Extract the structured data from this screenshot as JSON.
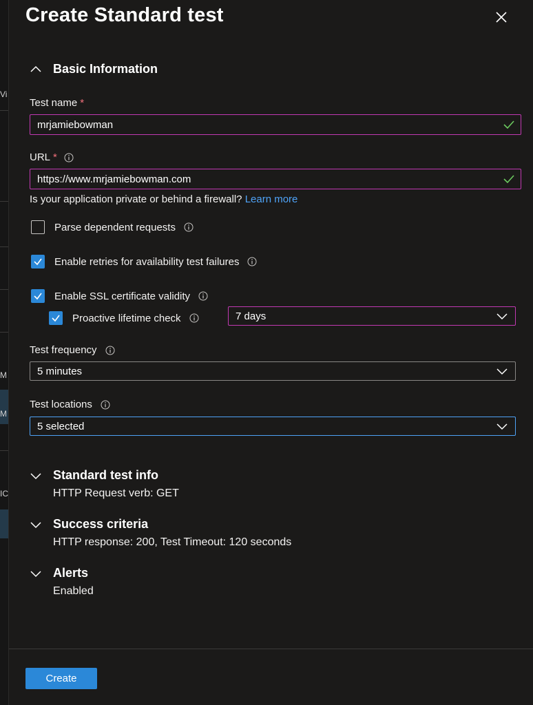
{
  "backdrop": {
    "fragments": [
      "Vi",
      "M",
      "M",
      "IC"
    ]
  },
  "panel": {
    "title": "Create Standard test"
  },
  "basic": {
    "heading": "Basic Information",
    "test_name_label": "Test name",
    "test_name_value": "mrjamiebowman",
    "url_label": "URL",
    "url_value": "https://www.mrjamiebowman.com",
    "firewall_text": "Is your application private or behind a firewall?",
    "learn_more": "Learn more",
    "parse_label": "Parse dependent requests",
    "parse_checked": false,
    "retries_label": "Enable retries for availability test failures",
    "retries_checked": true,
    "ssl_label": "Enable SSL certificate validity",
    "ssl_checked": true,
    "proactive_label": "Proactive lifetime check",
    "proactive_checked": true,
    "proactive_value": "7 days",
    "frequency_label": "Test frequency",
    "frequency_value": "5 minutes",
    "locations_label": "Test locations",
    "locations_value": "5 selected"
  },
  "sections": [
    {
      "heading": "Standard test info",
      "summary": "HTTP Request verb: GET"
    },
    {
      "heading": "Success criteria",
      "summary": "HTTP response: 200, Test Timeout: 120 seconds"
    },
    {
      "heading": "Alerts",
      "summary": "Enabled"
    }
  ],
  "footer": {
    "create_label": "Create"
  },
  "colors": {
    "accent": "#2b88d8",
    "focus_border": "#c239b3",
    "valid_check": "#6ccb5f",
    "required": "#f1707b",
    "link": "#4fa3f7"
  }
}
